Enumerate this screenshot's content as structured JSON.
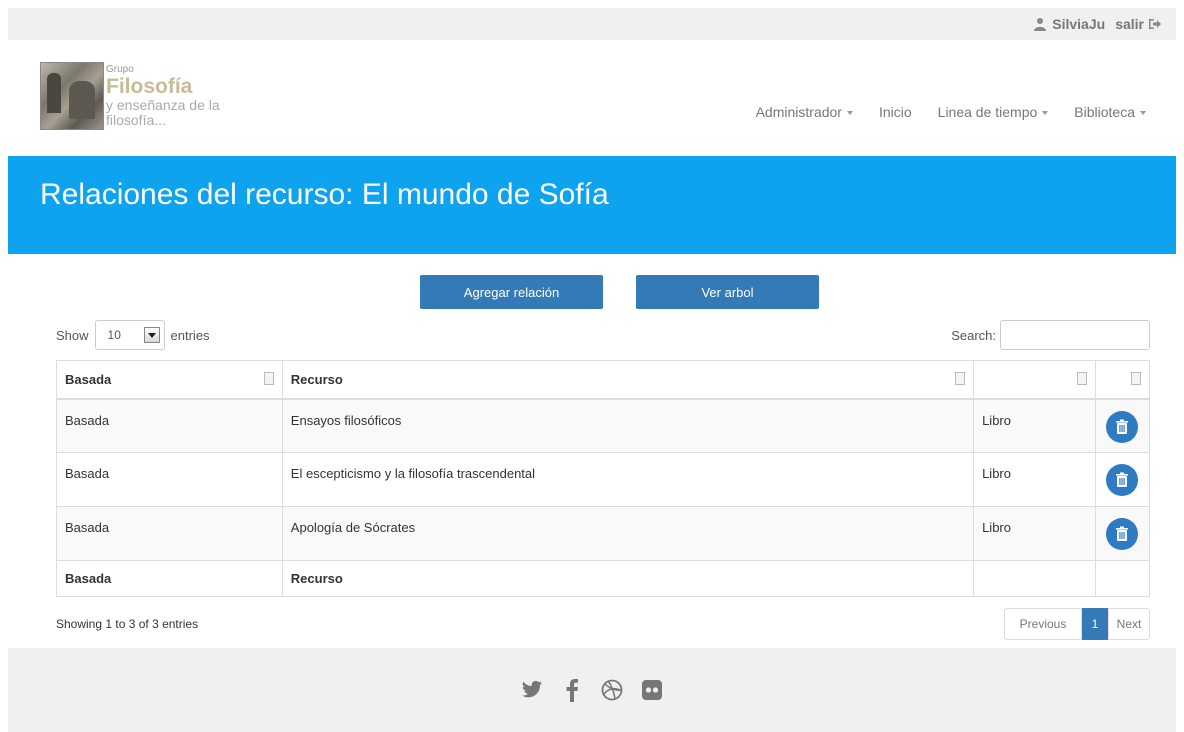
{
  "topbar": {
    "username": "SilviaJu",
    "logout_label": "salir",
    "user_icon": "user-icon",
    "logout_icon": "sign-out-icon"
  },
  "logo": {
    "line1": "Grupo",
    "line2": "Filosofía",
    "line3": "y enseñanza de la",
    "line4": "filosofía..."
  },
  "nav": {
    "items": [
      {
        "label": "Administrador",
        "dropdown": true
      },
      {
        "label": "Inicio",
        "dropdown": false
      },
      {
        "label": "Linea de tiempo",
        "dropdown": true
      },
      {
        "label": "Biblioteca",
        "dropdown": true
      }
    ]
  },
  "banner": {
    "title": "Relaciones del recurso: El mundo de Sofía",
    "color": "#0da3ee"
  },
  "actions": {
    "add_relation": "Agregar relación",
    "view_tree": "Ver arbol",
    "color": "#337ab7"
  },
  "length_control": {
    "prefix": "Show",
    "value": "10",
    "suffix": "entries"
  },
  "search": {
    "label": "Search:",
    "value": ""
  },
  "table": {
    "headers": [
      "Basada",
      "Recurso",
      "",
      ""
    ],
    "rows": [
      {
        "basada": "Basada",
        "recurso": "Ensayos filosóficos",
        "tipo": "Libro"
      },
      {
        "basada": "Basada",
        "recurso": "El escepticismo y la filosofía trascendental",
        "tipo": "Libro"
      },
      {
        "basada": "Basada",
        "recurso": "Apología de Sócrates",
        "tipo": "Libro"
      }
    ],
    "footers": [
      "Basada",
      "Recurso",
      "",
      ""
    ],
    "delete_icon": "trash-icon"
  },
  "info": "Showing 1 to 3 of 3 entries",
  "pagination": {
    "previous": "Previous",
    "current": "1",
    "next": "Next"
  },
  "footer": {
    "icons": [
      "twitter-icon",
      "facebook-icon",
      "dribbble-icon",
      "flickr-icon"
    ]
  }
}
